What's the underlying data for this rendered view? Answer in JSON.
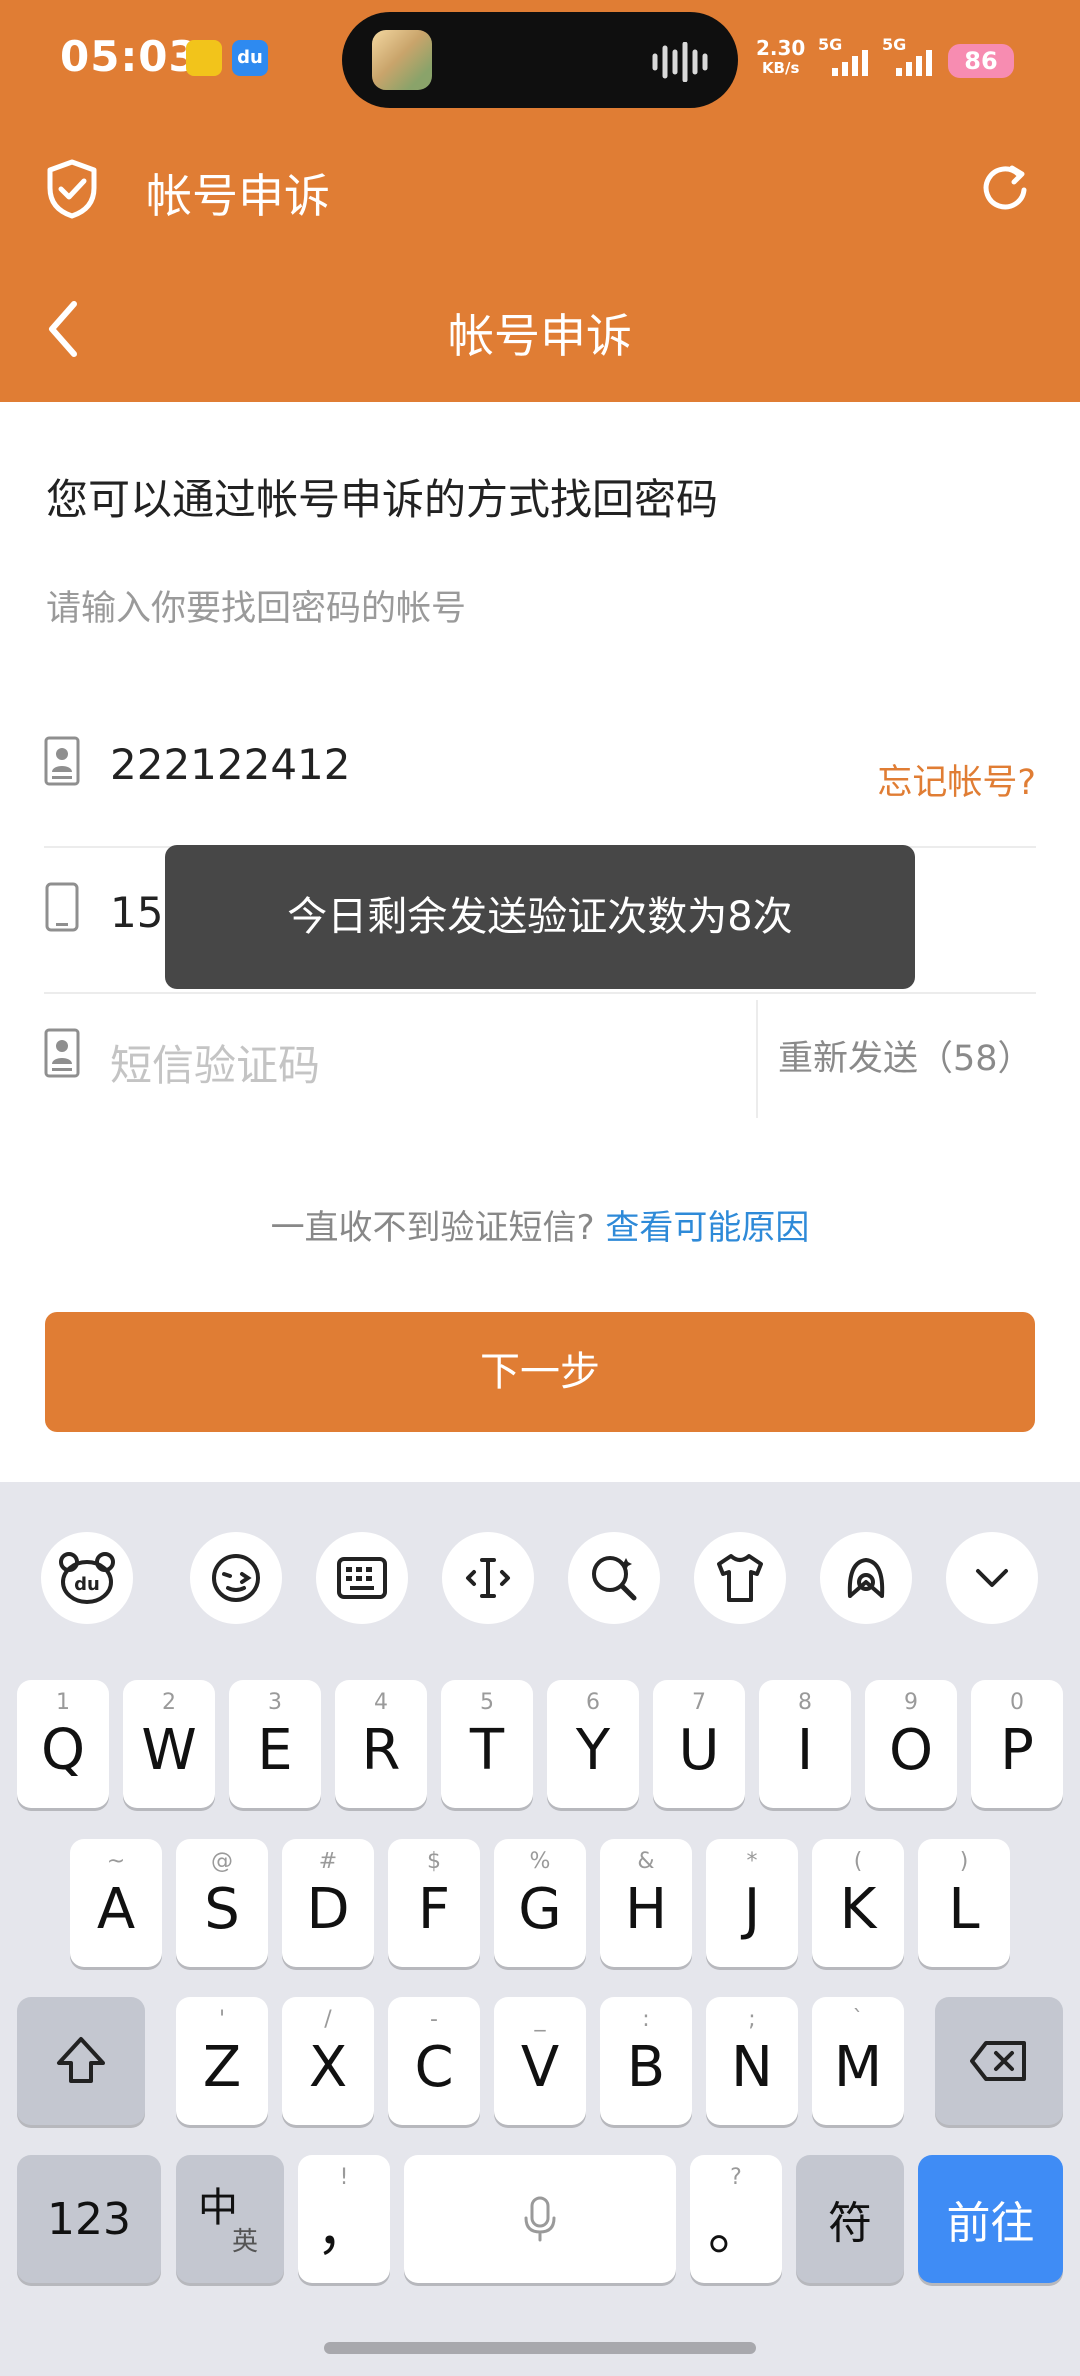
{
  "status": {
    "time": "05:03",
    "net_speed_value": "2.30",
    "net_speed_unit": "KB/s",
    "net1": "5G",
    "net2": "5G",
    "battery": "86"
  },
  "titlebar": {
    "title": "帐号申诉"
  },
  "navbar": {
    "title": "帐号申诉"
  },
  "content": {
    "heading": "您可以通过帐号申诉的方式找回密码",
    "subtitle": "请输入你要找回密码的帐号",
    "account_value": "222122412",
    "forget_label": "忘记帐号?",
    "phone_value": "151",
    "sms_placeholder": "短信验证码",
    "resend_label": "重新发送（58）",
    "tip_text": "一直收不到验证短信?",
    "tip_link": "查看可能原因",
    "next_label": "下一步"
  },
  "toast": {
    "text": "今日剩余发送验证次数为8次"
  },
  "keyboard": {
    "row1": [
      {
        "num": "1",
        "key": "Q"
      },
      {
        "num": "2",
        "key": "W"
      },
      {
        "num": "3",
        "key": "E"
      },
      {
        "num": "4",
        "key": "R"
      },
      {
        "num": "5",
        "key": "T"
      },
      {
        "num": "6",
        "key": "Y"
      },
      {
        "num": "7",
        "key": "U"
      },
      {
        "num": "8",
        "key": "I"
      },
      {
        "num": "9",
        "key": "O"
      },
      {
        "num": "0",
        "key": "P"
      }
    ],
    "row2": [
      {
        "num": "~",
        "key": "A"
      },
      {
        "num": "@",
        "key": "S"
      },
      {
        "num": "#",
        "key": "D"
      },
      {
        "num": "$",
        "key": "F"
      },
      {
        "num": "%",
        "key": "G"
      },
      {
        "num": "&",
        "key": "H"
      },
      {
        "num": "*",
        "key": "J"
      },
      {
        "num": "(",
        "key": "K"
      },
      {
        "num": ")",
        "key": "L"
      }
    ],
    "row3": [
      {
        "num": "'",
        "key": "Z"
      },
      {
        "num": "/",
        "key": "X"
      },
      {
        "num": "-",
        "key": "C"
      },
      {
        "num": "_",
        "key": "V"
      },
      {
        "num": ":",
        "key": "B"
      },
      {
        "num": ";",
        "key": "N"
      },
      {
        "num": "`",
        "key": "M"
      }
    ],
    "num_label": "123",
    "lang_main": "中",
    "lang_sub": "英",
    "comma_hint": "!",
    "comma": "，",
    "period_hint": "?",
    "period": "。",
    "symbol_label": "符",
    "go_label": "前往"
  },
  "colors": {
    "accent": "#E07D34",
    "link": "#2E8AD8",
    "go": "#3F8CF5"
  }
}
